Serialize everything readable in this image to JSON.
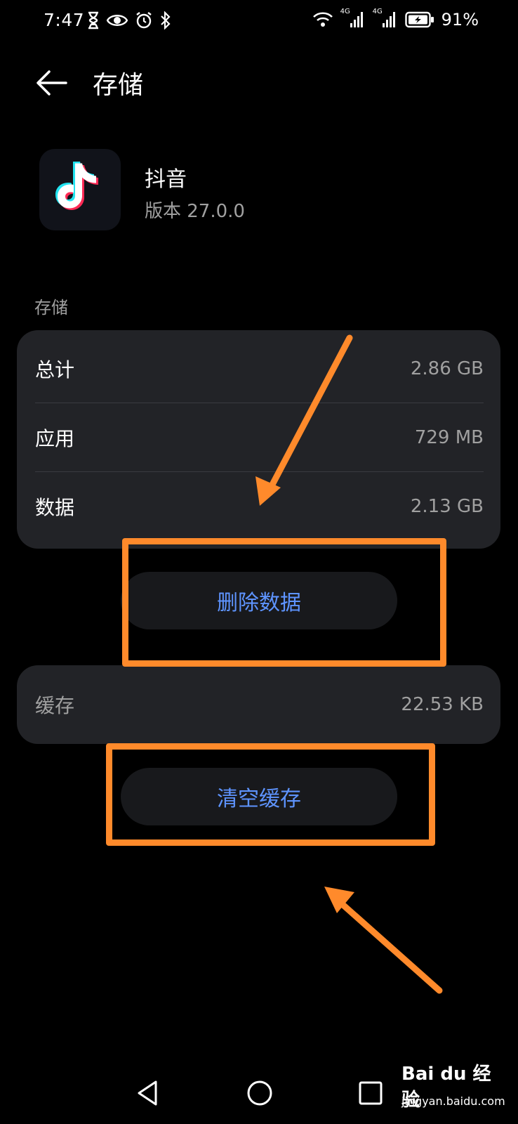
{
  "status_bar": {
    "time": "7:47",
    "battery_percent": "91%",
    "network_badge_1": "4G",
    "network_badge_2": "4G"
  },
  "app_bar": {
    "title": "存储"
  },
  "app": {
    "name": "抖音",
    "version": "版本 27.0.0"
  },
  "storage_section": {
    "label": "存储",
    "rows": [
      {
        "label": "总计",
        "value": "2.86 GB"
      },
      {
        "label": "应用",
        "value": "729 MB"
      },
      {
        "label": "数据",
        "value": "2.13 GB"
      }
    ],
    "delete_button": "删除数据"
  },
  "cache_section": {
    "label": "缓存",
    "value": "22.53 KB",
    "clear_button": "清空缓存"
  },
  "watermark": {
    "brand": "Bai du 经验",
    "url": "jingyan.baidu.com"
  },
  "colors": {
    "background": "#000000",
    "card": "#222327",
    "button": "#18191c",
    "accent_blue": "#5e94ff",
    "annotation_orange": "#ff8a2b",
    "secondary_text": "#a0a0a0"
  }
}
